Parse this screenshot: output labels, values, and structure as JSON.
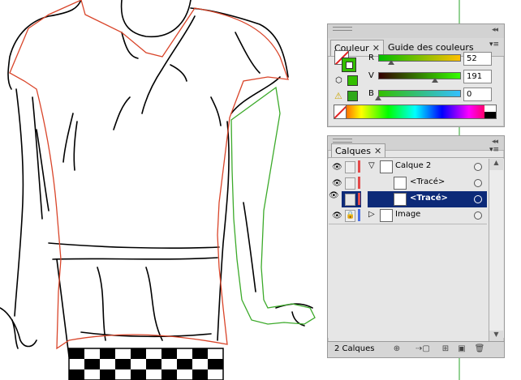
{
  "couleur_panel": {
    "tab_active": "Couleur",
    "tab_inactive": "Guide des couleurs",
    "channels": [
      {
        "letter": "R",
        "value": "52"
      },
      {
        "letter": "V",
        "value": "191"
      },
      {
        "letter": "B",
        "value": "0"
      }
    ],
    "fill_color": "#34bf00",
    "slider_fractions": [
      0.2,
      0.75,
      0.0
    ]
  },
  "calques_panel": {
    "tab_label": "Calques",
    "layers": [
      {
        "name": "Calque 2",
        "type": "layer",
        "color": "#e34a4a"
      },
      {
        "name": "<Tracé>",
        "type": "path",
        "color": "#e34a4a"
      },
      {
        "name": "<Tracé>",
        "type": "path",
        "color": "#e34a4a",
        "selected": true
      },
      {
        "name": "Image",
        "type": "layer",
        "color": "#4a6ee3"
      }
    ],
    "footer_count": "2 Calques"
  },
  "colors": {
    "panel_bg": "#e6e6e6",
    "selection": "#0d2a78",
    "guide_line": "#2aa52a",
    "trace_red": "#d9452a",
    "trace_green": "#3caa2a"
  },
  "icons": [
    "close-icon",
    "panel-menu-icon",
    "eye-icon",
    "lock-icon",
    "disclosure-triangle-icon",
    "target-circle-icon",
    "warning-icon",
    "cube-icon",
    "new-layer-icon",
    "trash-icon"
  ]
}
